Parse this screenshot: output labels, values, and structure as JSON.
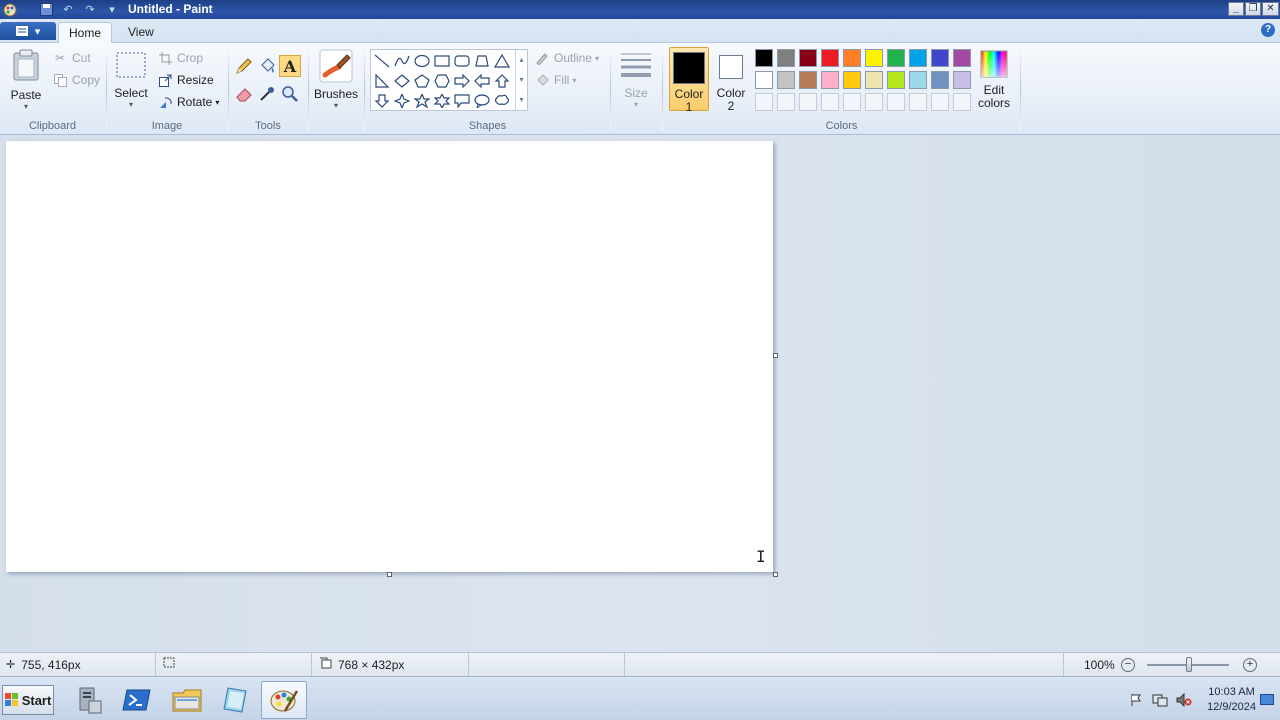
{
  "window": {
    "title": "Untitled - Paint"
  },
  "tabs": [
    {
      "label": "Home"
    },
    {
      "label": "View"
    }
  ],
  "ribbon": {
    "clipboard": {
      "group_label": "Clipboard",
      "paste": "Paste",
      "cut": "Cut",
      "copy": "Copy"
    },
    "image": {
      "group_label": "Image",
      "select": "Select",
      "crop": "Crop",
      "resize": "Resize",
      "rotate": "Rotate"
    },
    "tools": {
      "group_label": "Tools"
    },
    "brushes": {
      "label": "Brushes"
    },
    "shapes": {
      "group_label": "Shapes",
      "outline": "Outline",
      "fill": "Fill"
    },
    "size": {
      "label": "Size"
    },
    "colors": {
      "group_label": "Colors",
      "color1": {
        "label": "Color",
        "index": "1",
        "value": "#000000"
      },
      "color2": {
        "label": "Color",
        "index": "2",
        "value": "#ffffff"
      },
      "edit_colors_line1": "Edit",
      "edit_colors_line2": "colors",
      "palette_row1": [
        "#000000",
        "#7f7f7f",
        "#880015",
        "#ed1c24",
        "#ff7f27",
        "#fff200",
        "#22b14c",
        "#00a2e8",
        "#3f48cc",
        "#a349a4"
      ],
      "palette_row2": [
        "#ffffff",
        "#c3c3c3",
        "#b97a57",
        "#ffaec9",
        "#ffc90e",
        "#efe4b0",
        "#b5e61d",
        "#99d9ea",
        "#7092be",
        "#c8bfe7"
      ]
    }
  },
  "status": {
    "cursor_position": "755, 416px",
    "canvas_size": "768 × 432px",
    "zoom": "100%",
    "zoom_level": 100
  },
  "taskbar": {
    "start": "Start",
    "time": "10:03 AM",
    "date": "12/9/2024"
  }
}
